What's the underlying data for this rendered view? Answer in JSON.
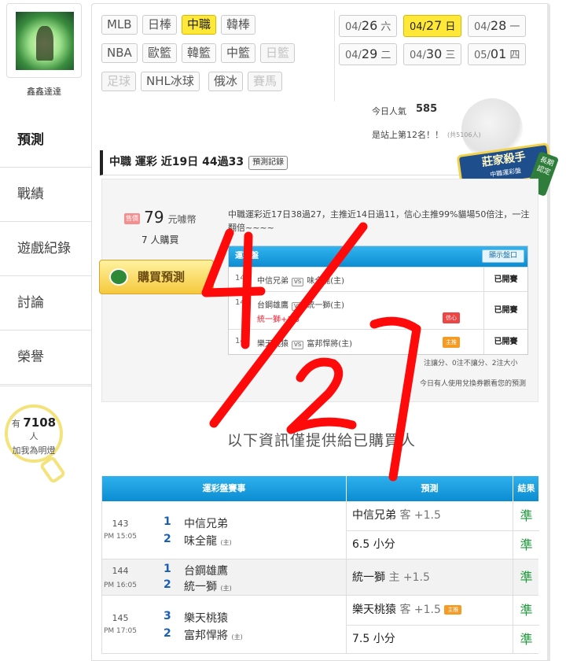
{
  "user": {
    "name": "鑫鑫達達"
  },
  "sidebar": {
    "items": [
      {
        "label": "預測"
      },
      {
        "label": "戰績"
      },
      {
        "label": "遊戲紀錄"
      },
      {
        "label": "討論"
      },
      {
        "label": "榮譽"
      }
    ],
    "fans": {
      "prefix": "有",
      "count": "7108",
      "suffix": "人",
      "text": "加我為明燈"
    }
  },
  "leagues": {
    "row1": [
      "MLB",
      "日棒",
      "中職",
      "韓棒"
    ],
    "row2": [
      "NBA",
      "歐籃",
      "韓籃",
      "中籃",
      "日籃"
    ],
    "row3": [
      "足球",
      "NHL冰球",
      "俄冰",
      "賽馬"
    ],
    "active": "中職"
  },
  "dates": {
    "row1": [
      {
        "md_small": "04/",
        "md_big": "26",
        "day": "六"
      },
      {
        "md_small": "04/",
        "md_big": "27",
        "day": "日"
      },
      {
        "md_small": "04/",
        "md_big": "28",
        "day": "一"
      }
    ],
    "row2": [
      {
        "md_small": "04/",
        "md_big": "29",
        "day": "二"
      },
      {
        "md_small": "04/",
        "md_big": "30",
        "day": "三"
      },
      {
        "md_small": "05/",
        "md_big": "01",
        "day": "四"
      }
    ]
  },
  "stats": {
    "popularity_label": "今日人氣",
    "popularity": "585",
    "rank_text": "是站上第12名！！",
    "rank_note": "(共5106人)"
  },
  "section": {
    "title": "中職 運彩 近19日 44過33",
    "record_button": "預測記錄",
    "badge_main": "莊家殺手",
    "badge_sub": "中職運彩盤",
    "badge_side": "長期認定"
  },
  "prediction": {
    "price_tag": "售價",
    "price": "79",
    "price_unit": "元噱幣",
    "buyers": "7 人購買",
    "buy_button": "購買預測",
    "description": "中職運彩近17日38過27，主推近14日過11，信心主推99%貓場50倍注，一注翻倍~~~~",
    "table_header": "運彩盤",
    "show_button": "顯示盤口",
    "rows": [
      {
        "no": "143",
        "away": "中信兄弟",
        "home": "味全龍(主)",
        "status": "已開賽"
      },
      {
        "no": "144",
        "away": "台鋼雄鷹",
        "home": "統一獅(主)",
        "note": "統一獅+1.5",
        "tip": "信心",
        "status": "已開賽"
      },
      {
        "no": "145",
        "away": "樂天桃猿",
        "home": "富邦悍將(主)",
        "tip": "主推",
        "status": "已開賽"
      }
    ],
    "vs": "VS",
    "legend": "注讓分、0注不讓分、2注大小",
    "notice": "今日有人使用兌換券觀看您的預測"
  },
  "info_text": "以下資訊僅提供給已購買人",
  "results": {
    "headers": {
      "match": "運彩盤賽事",
      "pick": "預測",
      "result": "結果"
    },
    "home_mark": "(主)",
    "games": [
      {
        "no": "143",
        "time": "PM 15:05",
        "team1_no": "1",
        "team1": "中信兄弟",
        "team2_no": "2",
        "team2": "味全龍",
        "picks": [
          {
            "text": "中信兄弟",
            "hcp": "客 +1.5",
            "result": "準"
          },
          {
            "text": "6.5 小分",
            "hcp": "",
            "result": "準"
          }
        ]
      },
      {
        "no": "144",
        "time": "PM 16:05",
        "team1_no": "1",
        "team1": "台鋼雄鷹",
        "team2_no": "2",
        "team2": "統一獅",
        "picks": [
          {
            "text": "統一獅",
            "hcp": "主 +1.5",
            "result": "準"
          }
        ]
      },
      {
        "no": "145",
        "time": "PM 17:05",
        "team1_no": "3",
        "team1": "樂天桃猿",
        "team2_no": "2",
        "team2": "富邦悍將",
        "picks": [
          {
            "text": "樂天桃猿",
            "hcp": "客 +1.5",
            "tag": "主推",
            "result": "準"
          },
          {
            "text": "7.5 小分",
            "hcp": "",
            "result": "準"
          }
        ]
      }
    ]
  },
  "annotation": {
    "color": "#ff0a0a",
    "text": "4/27"
  },
  "colors": {
    "accent_yellow": "#ffe838",
    "table_blue": "#0d8dd2",
    "result_green": "#1f9a3b"
  }
}
